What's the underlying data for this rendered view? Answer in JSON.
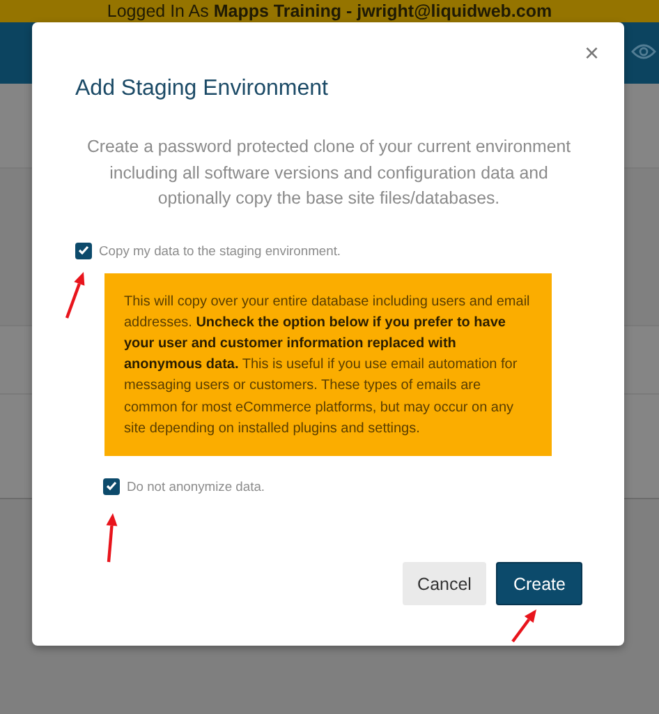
{
  "banner": {
    "text": "Logged In As **Mapps Training - jwright@liquidweb.com**"
  },
  "dialog": {
    "title": "Add Staging Environment",
    "close": "×",
    "description": "Create a password protected clone of your current environment including all software versions and configuration data and optionally copy the base site files/databases.",
    "options": [
      {
        "label": "Copy my data to the staging environment.",
        "checked": true,
        "notice": "This will copy over your entire database including users and email addresses. **Uncheck the option below if you prefer to have your user and customer information replaced with anonymous data.** This is useful if you use email automation for messaging users or customers. These types of emails are common for most eCommerce platforms, but may occur on any site depending on installed plugins and settings."
      },
      {
        "label": "Do not anonymize data.",
        "checked": true
      }
    ],
    "buttons": [
      {
        "label": "Cancel",
        "kind": "secondary"
      },
      {
        "label": "Create",
        "kind": "primary"
      }
    ]
  }
}
